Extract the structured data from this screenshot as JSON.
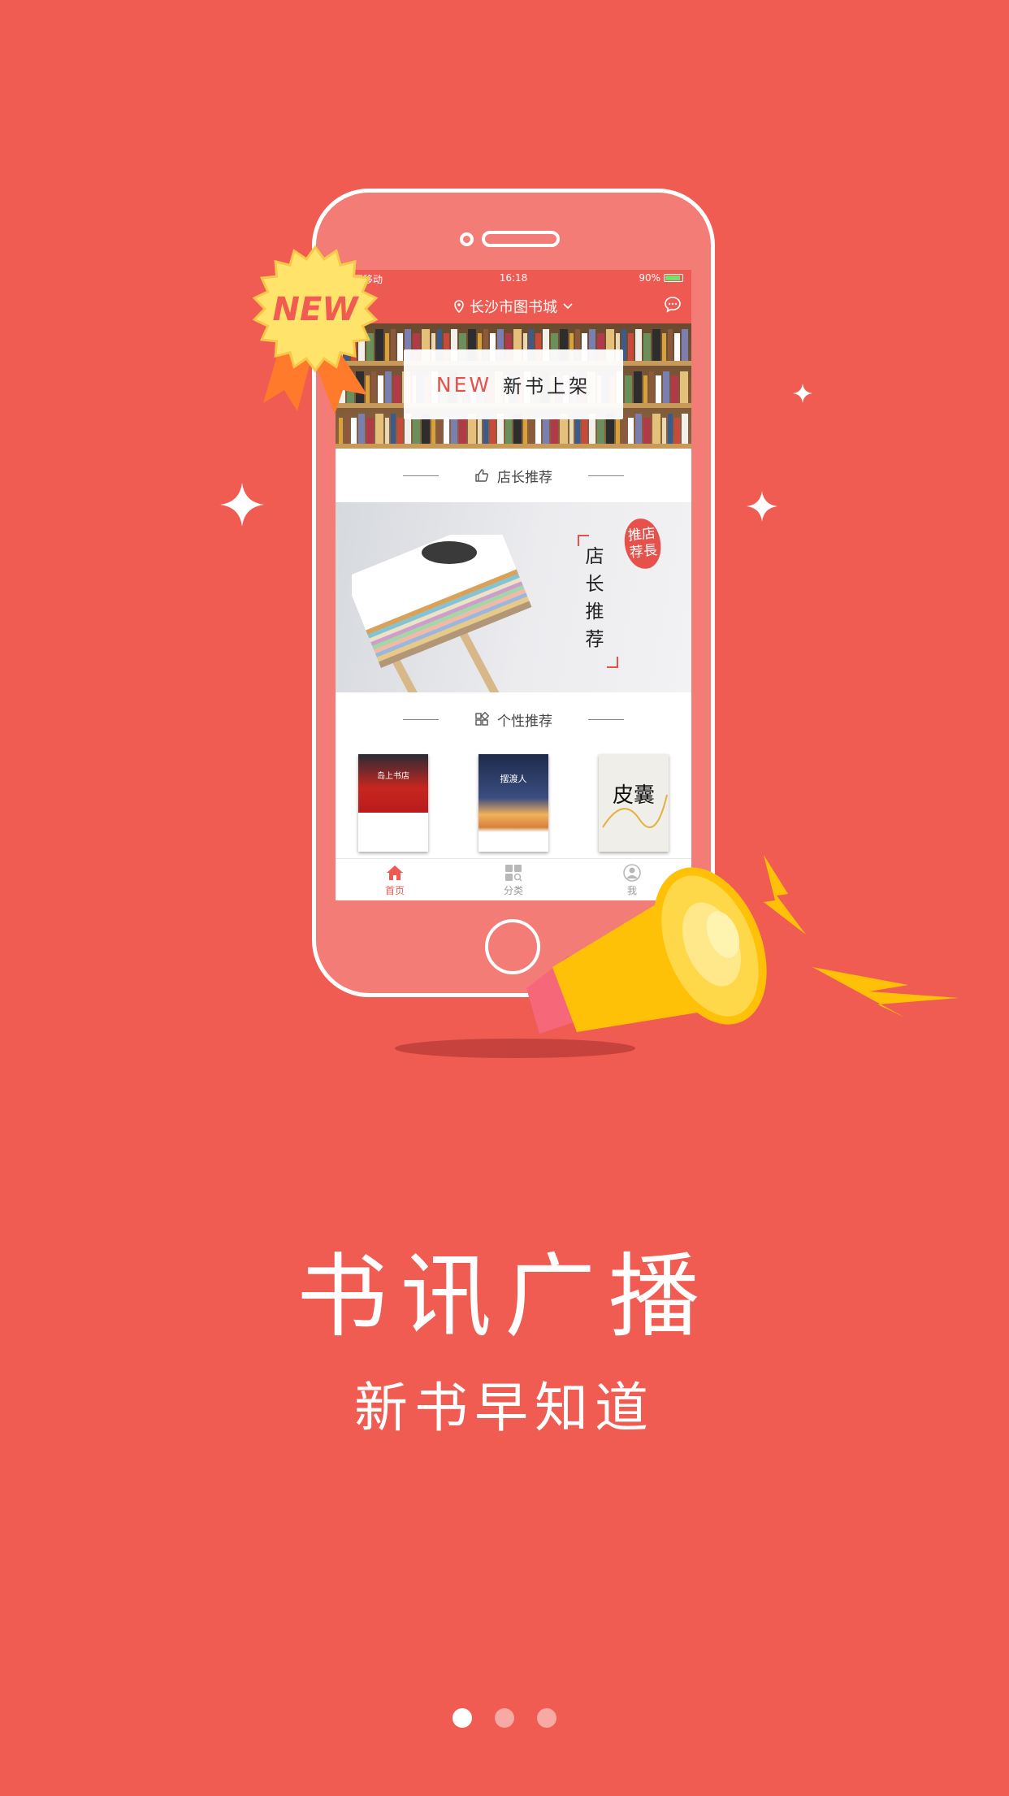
{
  "status_bar": {
    "carrier": "中国移动",
    "time": "16:18",
    "battery": "90%",
    "battery_level": 0.9
  },
  "nav": {
    "location": "长沙市图书城"
  },
  "badge": {
    "text": "NEW"
  },
  "banner": {
    "new_text": "NEW",
    "label": "新书上架"
  },
  "sections": {
    "shop_recommend": "店长推荐",
    "personal_recommend": "个性推荐"
  },
  "feature": {
    "vertical_text": [
      "店",
      "长",
      "推",
      "荐"
    ],
    "stamp": [
      "推店",
      "荐長"
    ]
  },
  "books": [
    {
      "title": "岛上书店"
    },
    {
      "title": "摆渡人"
    },
    {
      "title": "皮囊"
    }
  ],
  "tabs": [
    {
      "label": "首页",
      "icon": "home-icon",
      "active": true
    },
    {
      "label": "分类",
      "icon": "category-icon",
      "active": false
    },
    {
      "label": "我",
      "icon": "user-icon",
      "active": false
    }
  ],
  "headline": "书讯广播",
  "subline": "新书早知道",
  "pagination": {
    "total": 3,
    "active": 0
  },
  "colors": {
    "background": "#f05b52",
    "accent": "#ee5a52",
    "badge": "#ffe36b",
    "megaphone": "#ffc107"
  }
}
